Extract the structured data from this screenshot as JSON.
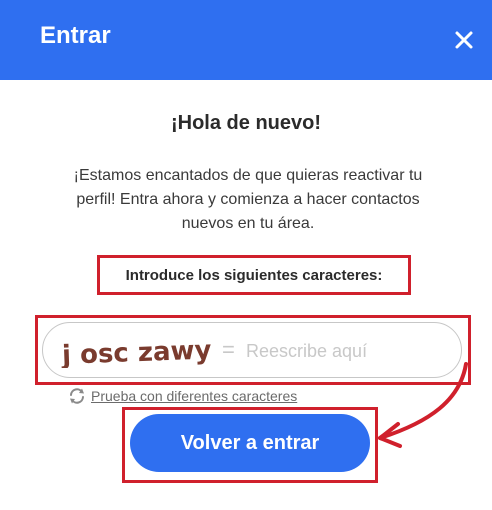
{
  "header": {
    "title": "Entrar",
    "close_icon": "close-icon",
    "background_color": "#2f6ff0"
  },
  "main": {
    "greeting": "¡Hola de nuevo!",
    "message_line1": "¡Estamos encantados de que quieras reactivar tu",
    "message_line2": "perfil! Entra ahora y comienza a hacer contactos",
    "message_line3": "nuevos en tu área.",
    "instruction": "Introduce los siguientes caracteres:",
    "captcha": {
      "image_text": "j osc zawy",
      "equals": "=",
      "placeholder": "Reescribe aquí",
      "value": ""
    },
    "refresh": {
      "label": "Prueba con diferentes caracteres",
      "icon": "refresh-icon"
    },
    "submit_label": "Volver a entrar"
  },
  "colors": {
    "accent": "#2f6ff0",
    "highlight": "#d0202c",
    "captcha_text": "#7a3b2e"
  }
}
